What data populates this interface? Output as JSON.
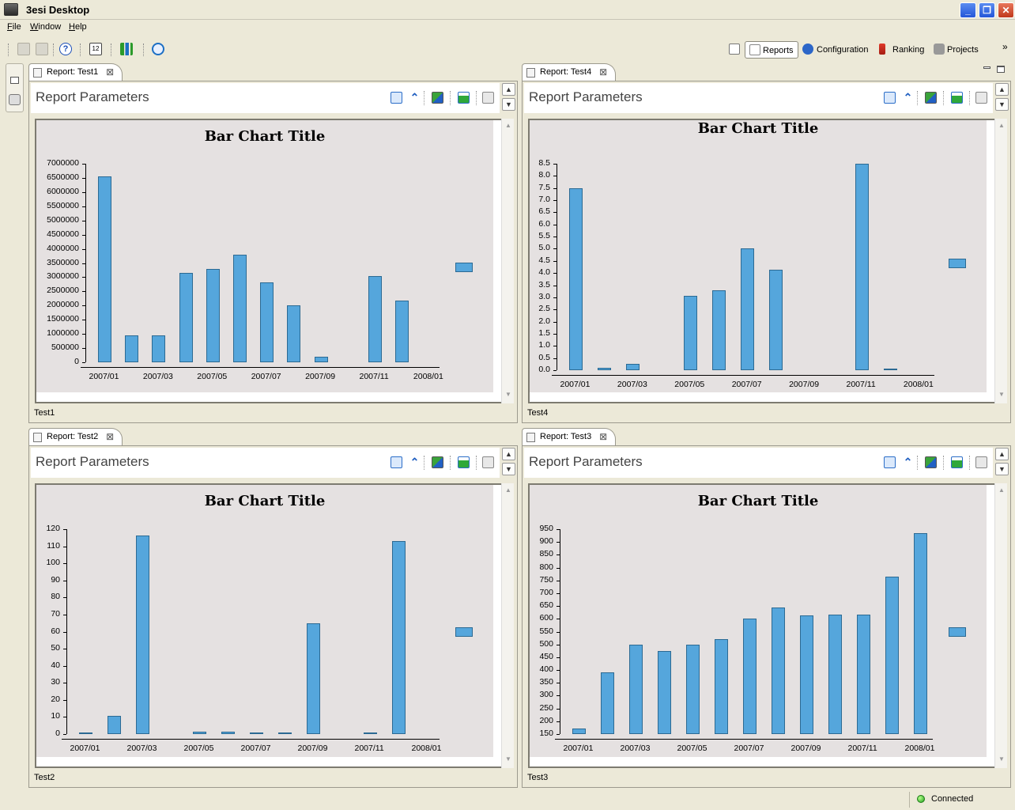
{
  "window": {
    "title": "3esi Desktop"
  },
  "menu": {
    "items": [
      "File",
      "Window",
      "Help"
    ]
  },
  "toolbar": {
    "icons": [
      "save-icon",
      "print-icon",
      "help-icon",
      "calendar-icon",
      "chart-icon",
      "network-icon"
    ]
  },
  "perspectives": {
    "items": [
      {
        "label": "Reports",
        "icon": "reports-icon",
        "active": true
      },
      {
        "label": "Configuration",
        "icon": "configuration-icon",
        "active": false
      },
      {
        "label": "Ranking",
        "icon": "ranking-icon",
        "active": false
      },
      {
        "label": "Projects",
        "icon": "projects-icon",
        "active": false
      }
    ],
    "overflow": "»"
  },
  "panels": [
    {
      "tab": "Report: Test1",
      "params_title": "Report Parameters",
      "footer": "Test1",
      "chart_data": {
        "type": "bar",
        "title": "Bar Chart Title",
        "yticks": [
          "7000000",
          "6500000",
          "6000000",
          "5500000",
          "5000000",
          "4500000",
          "4000000",
          "3500000",
          "3000000",
          "2500000",
          "2000000",
          "1500000",
          "1000000",
          "500000",
          "0"
        ],
        "ylim": [
          0,
          7000000
        ],
        "xticks": [
          "2007/01",
          "2007/03",
          "2007/05",
          "2007/07",
          "2007/09",
          "2007/11",
          "2008/01"
        ],
        "categories": [
          "2007/01",
          "2007/02",
          "2007/03",
          "2007/04",
          "2007/05",
          "2007/06",
          "2007/07",
          "2007/08",
          "2007/09",
          "2007/10",
          "2007/11",
          "2007/12",
          "2008/01"
        ],
        "values": [
          6550000,
          950000,
          950000,
          3150000,
          3300000,
          3800000,
          2830000,
          2000000,
          200000,
          0,
          3050000,
          2170000,
          0
        ]
      }
    },
    {
      "tab": "Report: Test4",
      "params_title": "Report Parameters",
      "footer": "Test4",
      "chart_data": {
        "type": "bar",
        "title": "Bar Chart Title",
        "yticks": [
          "8.5",
          "8.0",
          "7.5",
          "7.0",
          "6.5",
          "6.0",
          "5.5",
          "5.0",
          "4.5",
          "4.0",
          "3.5",
          "3.0",
          "2.5",
          "2.0",
          "1.5",
          "1.0",
          "0.5",
          "0.0"
        ],
        "ylim": [
          0,
          8.5
        ],
        "xticks": [
          "2007/01",
          "2007/03",
          "2007/05",
          "2007/07",
          "2007/09",
          "2007/11",
          "2008/01"
        ],
        "categories": [
          "2007/01",
          "2007/02",
          "2007/03",
          "2007/04",
          "2007/05",
          "2007/06",
          "2007/07",
          "2007/08",
          "2007/09",
          "2007/10",
          "2007/11",
          "2007/12",
          "2008/01"
        ],
        "values": [
          7.5,
          0.1,
          0.25,
          0,
          3.05,
          3.3,
          5.0,
          4.15,
          0,
          0,
          8.5,
          0.05,
          0
        ]
      }
    },
    {
      "tab": "Report: Test2",
      "params_title": "Report Parameters",
      "footer": "Test2",
      "chart_data": {
        "type": "bar",
        "title": "Bar Chart Title",
        "yticks": [
          "120",
          "110",
          "100",
          "90",
          "80",
          "70",
          "60",
          "50",
          "40",
          "30",
          "20",
          "10",
          "0"
        ],
        "ylim": [
          0,
          120
        ],
        "xticks": [
          "2007/01",
          "2007/03",
          "2007/05",
          "2007/07",
          "2007/09",
          "2007/11",
          "2008/01"
        ],
        "categories": [
          "2007/01",
          "2007/02",
          "2007/03",
          "2007/04",
          "2007/05",
          "2007/06",
          "2007/07",
          "2007/08",
          "2007/09",
          "2007/10",
          "2007/11",
          "2007/12",
          "2008/01"
        ],
        "values": [
          0.8,
          10.5,
          116.5,
          0,
          1.2,
          1.2,
          0.8,
          0.8,
          65,
          0,
          0.4,
          113,
          0
        ]
      }
    },
    {
      "tab": "Report: Test3",
      "params_title": "Report Parameters",
      "footer": "Test3",
      "chart_data": {
        "type": "bar",
        "title": "Bar Chart Title",
        "yticks": [
          "950",
          "900",
          "850",
          "800",
          "750",
          "700",
          "650",
          "600",
          "550",
          "500",
          "450",
          "400",
          "350",
          "300",
          "250",
          "200",
          "150"
        ],
        "ylim": [
          150,
          950
        ],
        "xticks": [
          "2007/01",
          "2007/03",
          "2007/05",
          "2007/07",
          "2007/09",
          "2007/11",
          "2008/01"
        ],
        "categories": [
          "2007/01",
          "2007/02",
          "2007/03",
          "2007/04",
          "2007/05",
          "2007/06",
          "2007/07",
          "2007/08",
          "2007/09",
          "2007/10",
          "2007/11",
          "2007/12",
          "2008/01"
        ],
        "values": [
          172,
          392,
          498,
          473,
          500,
          520,
          600,
          643,
          612,
          615,
          615,
          765,
          935
        ]
      }
    }
  ],
  "status": {
    "text": "Connected",
    "color": "#22a020"
  },
  "colors": {
    "bar": "#55a6dc",
    "bar_border": "#2c6a93",
    "plot_bg": "#e5e1e1",
    "chrome": "#ece9d8"
  }
}
